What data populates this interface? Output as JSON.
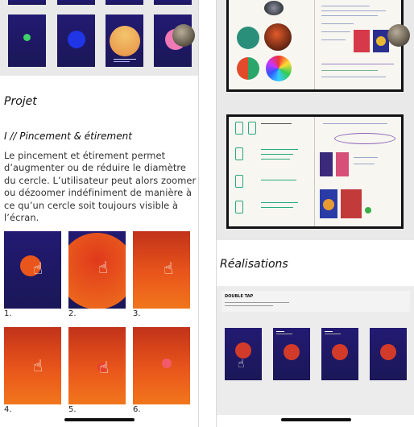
{
  "left": {
    "section_title": "Projet",
    "subsection_title": "I // Pincement & étirement",
    "paragraph": "Le pincement et étirement permet d’augmenter ou de réduire le diamètre du cercle. L’utilisateur peut alors zoomer ou dézoomer indéfiniment de manière à ce qu’un cercle soit toujours visible à l’écran.",
    "top_posters": [
      {
        "circle_color": "#3fd06a"
      },
      {
        "circle_color": "#1f35e6"
      },
      {
        "circle_color": "#f0b25a"
      },
      {
        "circle_color": "#f07ab6"
      }
    ],
    "steps": [
      {
        "number": "1.",
        "hand": "☝"
      },
      {
        "number": "2.",
        "hand": "☝"
      },
      {
        "number": "3.",
        "hand": "☝"
      },
      {
        "number": "4.",
        "hand": "☝"
      },
      {
        "number": "5.",
        "hand": "☝"
      },
      {
        "number": "6.",
        "hand": ""
      }
    ]
  },
  "right": {
    "section_title": "Réalisations",
    "notebook_top": {
      "description_icon": "notebook-sketch"
    },
    "notebook_bottom": {
      "notes": [
        "1. Défilé mode",
        "cercle",
        "pincement & étirement",
        "= agrandissement ou",
        "= rapetissement",
        "Touche = Duplication",
        "Balayage (swipe)"
      ]
    },
    "canvas": {
      "title": "DOUBLE TAP",
      "screens": [
        {
          "id": "screen-1",
          "hand": "☝"
        },
        {
          "id": "screen-2",
          "hand": ""
        },
        {
          "id": "screen-3",
          "hand": ""
        },
        {
          "id": "screen-4",
          "hand": ""
        }
      ]
    }
  },
  "colors": {
    "navy": "#1f1860",
    "orange": "#e9561b",
    "red_circle": "#e8402a"
  }
}
